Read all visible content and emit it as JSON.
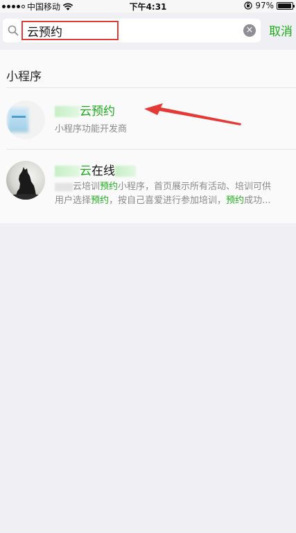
{
  "status_bar": {
    "carrier": "中国移动",
    "time": "下午4:31",
    "battery_percent": "97%",
    "battery_level": 0.97
  },
  "search": {
    "query": "云预约",
    "cancel_label": "取消"
  },
  "results": {
    "section_title": "小程序",
    "items": [
      {
        "title_highlight": "云预约",
        "subtitle": "小程序功能开发商"
      },
      {
        "title_highlight": "云",
        "title_rest": "在线",
        "desc_line1_prefix": "云培训",
        "desc_line1_hl": "预约",
        "desc_line1_rest": "小程序，首页展示所有活动、培训可供",
        "desc_line2_a": "用户选择",
        "desc_line2_hl1": "预约",
        "desc_line2_b": "，按自己喜爱进行参加培训，",
        "desc_line2_hl2": "预约",
        "desc_line2_c": "成功..."
      }
    ]
  },
  "colors": {
    "accent_green": "#1aad19",
    "annotation_red": "#e53935"
  },
  "icons": [
    "search-icon",
    "clear-icon",
    "wifi-icon",
    "signal-icon",
    "battery-icon",
    "lock-rotation-icon",
    "red-arrow-annotation",
    "wolf-avatar"
  ]
}
